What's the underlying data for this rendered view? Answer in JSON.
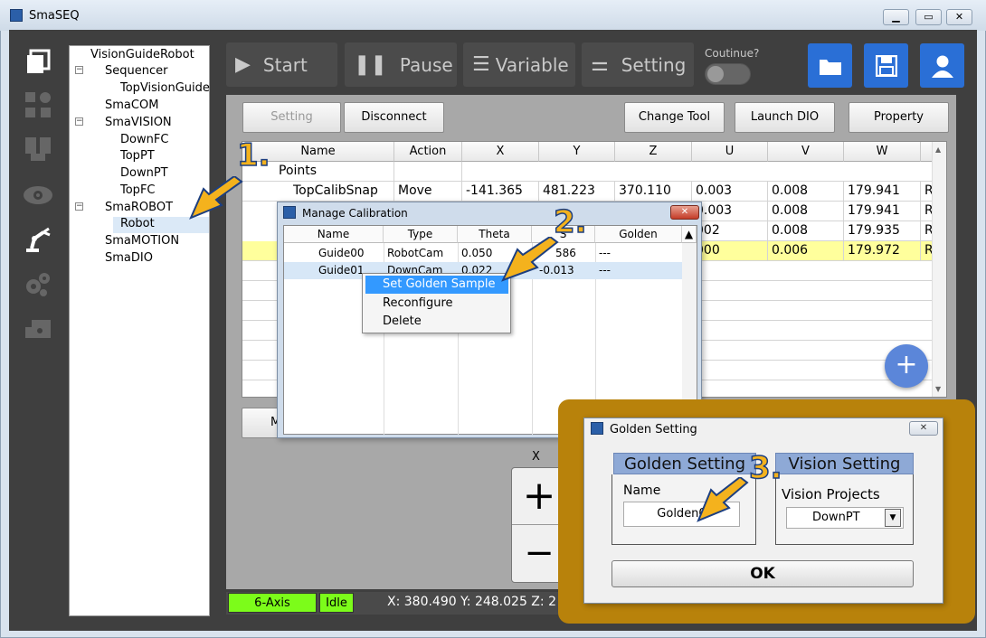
{
  "window": {
    "title": "SmaSEQ",
    "min": "▭",
    "max": "▭",
    "close": "✕"
  },
  "sidebar": {
    "icons": [
      "copy-icon",
      "flow-icon",
      "layout-icon",
      "eye-icon",
      "robot-arm-icon",
      "gears-icon",
      "device-icon"
    ]
  },
  "tree": {
    "root": "VisionGuideRobot",
    "items": [
      "Sequencer",
      "TopVisionGuide",
      "SmaCOM",
      "SmaVISION",
      "DownFC",
      "TopPT",
      "DownPT",
      "TopFC",
      "SmaROBOT",
      "Robot",
      "SmaMOTION",
      "SmaDIO"
    ]
  },
  "toolbar": {
    "start": "Start",
    "pause": "Pause",
    "variable": "Variable",
    "setting": "Setting",
    "continue_label": "Coutinue?"
  },
  "actions": {
    "setting": "Setting",
    "disconnect": "Disconnect",
    "change_tool": "Change Tool",
    "launch_dio": "Launch DIO",
    "property": "Property"
  },
  "grid": {
    "headers": [
      "Name",
      "Action",
      "X",
      "Y",
      "Z",
      "U",
      "V",
      "W"
    ],
    "group": "Points",
    "rows": [
      {
        "name": "TopCalibSnap",
        "action": "Move",
        "x": "-141.365",
        "y": "481.223",
        "z": "370.110",
        "u": "0.003",
        "v": "0.008",
        "w": "179.941",
        "extra": "R"
      },
      {
        "name": "",
        "action": "",
        "x": "",
        "y": "",
        "z": "",
        "u": "0.003",
        "v": "0.008",
        "w": "179.941",
        "extra": "R"
      },
      {
        "name": "",
        "action": "",
        "x": "",
        "y": "",
        "z": "",
        "u": "002",
        "v": "0.008",
        "w": "179.935",
        "extra": "R"
      },
      {
        "name": "",
        "action": "",
        "x": "",
        "y": "",
        "z": "",
        "u": "000",
        "v": "0.006",
        "w": "179.972",
        "extra": "R"
      }
    ]
  },
  "left_button_partial": "M",
  "jog": {
    "axis": "X",
    "plus": "+",
    "minus": "−"
  },
  "status": {
    "axis_mode": "6-Axis",
    "state": "Idle",
    "coords": "X: 380.490 Y: 248.025 Z: 2"
  },
  "manage_calibration": {
    "title": "Manage Calibration",
    "headers": [
      "Name",
      "Type",
      "Theta",
      "S",
      "Golden"
    ],
    "rows": [
      {
        "name": "Guide00",
        "type": "RobotCam",
        "theta": "0.050",
        "s": "586",
        "golden": "---"
      },
      {
        "name": "Guide01",
        "type": "DownCam",
        "theta": "0.022",
        "s": "-0.013",
        "golden": "---"
      }
    ],
    "context_menu": [
      "Set Golden Sample",
      "Reconfigure",
      "Delete"
    ]
  },
  "golden_dialog": {
    "title": "Golden Setting",
    "tab_golden": "Golden Setting",
    "tab_vision": "Vision Setting",
    "name_label": "Name",
    "name_value": "Golden0",
    "vision_label": "Vision Projects",
    "vision_value": "DownPT",
    "ok": "OK"
  },
  "annotations": {
    "step1": "1.",
    "step2": "2.",
    "step3": "3."
  },
  "colors": {
    "accent": "#2a6fd6",
    "status_green": "#7cfc1a",
    "highlight_row": "#ffff9c",
    "callout_frame": "#b8820b",
    "arrow": "#f4b21d"
  }
}
